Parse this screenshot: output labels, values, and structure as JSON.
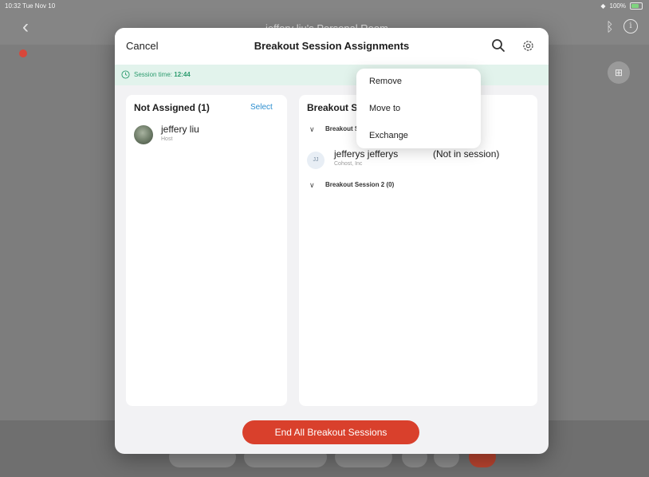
{
  "status_bar": {
    "time": "10:32  Tue Nov 10",
    "battery": "100%"
  },
  "background": {
    "title": "jeffery liu's Personal Room"
  },
  "modal": {
    "cancel_label": "Cancel",
    "title": "Breakout Session Assignments",
    "session_time_label": "Session time:",
    "session_time_value": "12:44"
  },
  "not_assigned": {
    "title": "Not Assigned (1)",
    "select_label": "Select",
    "participants": [
      {
        "name": "jeffery liu",
        "role": "Host"
      }
    ]
  },
  "breakout": {
    "title": "Breakout Sessions",
    "session_1_label": "Breakout Session 1 (1)",
    "participant_initials": "JJ",
    "participant_name": "jefferys jefferys",
    "participant_status": "(Not in session)",
    "participant_company": "Cohost, Inc",
    "session_2_label": "Breakout Session 2 (0)"
  },
  "end_button_label": "End All Breakout Sessions",
  "context_menu": {
    "items": [
      "Remove",
      "Move to",
      "Exchange"
    ]
  }
}
